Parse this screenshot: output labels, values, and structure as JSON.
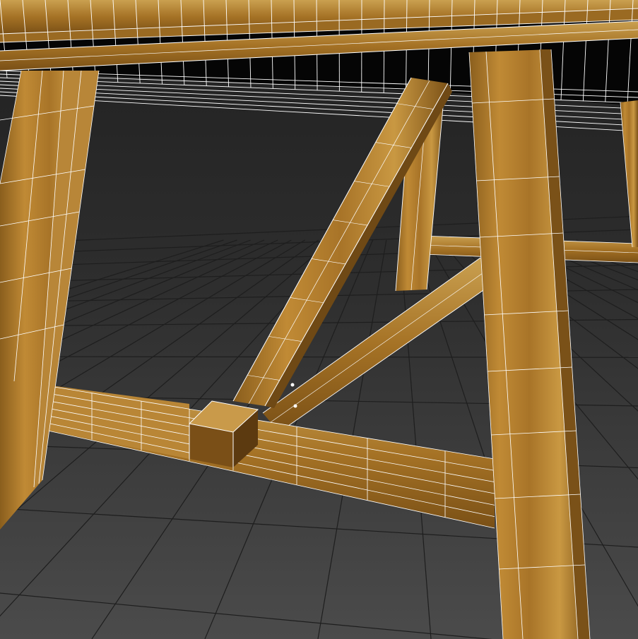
{
  "viewport": {
    "kind": "3d-viewport-wireframe-shaded",
    "background_top": "#222222",
    "background_bottom": "#4a4a4a",
    "grid_color": "#1c1c1c",
    "wire_color": "#ffffff",
    "wood_light": "#c9973f",
    "wood_mid": "#a87528",
    "wood_dark": "#6e4a17"
  },
  "scene": {
    "object": "wooden-table-underside",
    "parts": [
      "tabletop",
      "apron-beam",
      "left-leg",
      "right-leg",
      "back-leg",
      "diagonal-brace",
      "diagonal-strut",
      "bottom-stretcher",
      "back-stretcher"
    ]
  }
}
